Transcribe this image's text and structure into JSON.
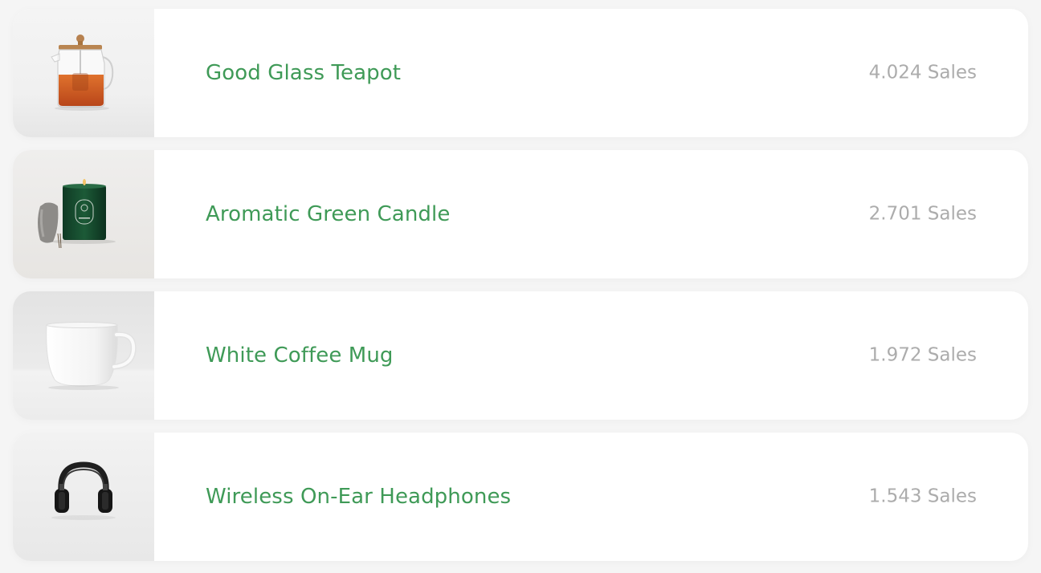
{
  "products": [
    {
      "name": "Good Glass Teapot",
      "sales": "4.024 Sales",
      "image": "glass-teapot-image"
    },
    {
      "name": "Aromatic Green Candle",
      "sales": "2.701 Sales",
      "image": "green-candle-image"
    },
    {
      "name": "White Coffee Mug",
      "sales": "1.972 Sales",
      "image": "white-mug-image"
    },
    {
      "name": "Wireless On-Ear Headphones",
      "sales": "1.543 Sales",
      "image": "headphones-image"
    }
  ],
  "colors": {
    "name_text": "#3f9a57",
    "sales_text": "#acacac",
    "card_bg": "#ffffff",
    "page_bg": "#f5f5f5"
  }
}
